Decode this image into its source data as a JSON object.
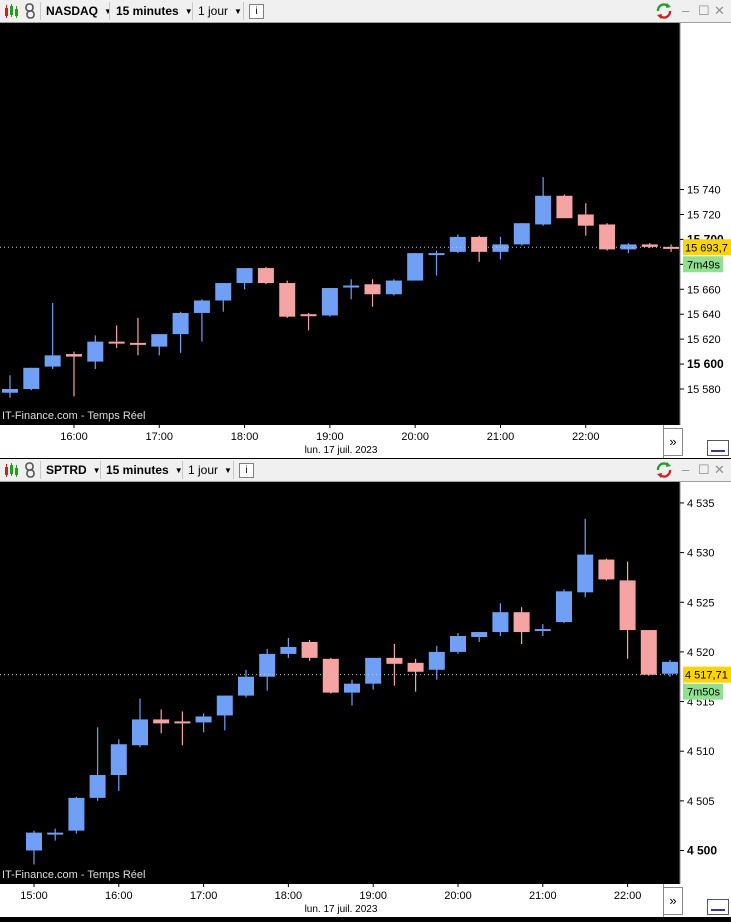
{
  "colors": {
    "up_candle": "#6fa0f5",
    "down_candle": "#f5a3a3",
    "price_tag": "#ffd400",
    "timer_tag": "#90e090"
  },
  "icons": [
    "candlestick-chart-icon",
    "link-icon",
    "info-icon",
    "refresh-icon",
    "minimize-icon",
    "restore-icon",
    "close-icon"
  ],
  "charts": [
    {
      "toolbar": {
        "symbol": "NASDAQ",
        "interval": "15 minutes",
        "period": "1 jour",
        "info": "i"
      },
      "window_buttons": {
        "minimize": "–",
        "restore": "☐",
        "close": "✕"
      },
      "source_label": "IT-Finance.com - Temps Réel",
      "date_label": "lun. 17 juil. 2023",
      "current_price": "15 693,7",
      "countdown": "7m49s",
      "scroll_label": "»"
    },
    {
      "toolbar": {
        "symbol": "SPTRD",
        "interval": "15 minutes",
        "period": "1 jour",
        "info": "i"
      },
      "window_buttons": {
        "minimize": "–",
        "restore": "☐",
        "close": "✕"
      },
      "source_label": "IT-Finance.com - Temps Réel",
      "date_label": "lun. 17 juil. 2023",
      "current_price": "4 517,71",
      "countdown": "7m50s",
      "scroll_label": "»"
    }
  ],
  "chart_data": [
    {
      "type": "candlestick",
      "title": "NASDAQ",
      "interval": "15 minutes",
      "ylim": [
        15564,
        15752
      ],
      "y_ticks": [
        15580,
        15600,
        15620,
        15640,
        15660,
        15680,
        15700,
        15720,
        15740
      ],
      "y_tick_labels": [
        "15 580",
        "15 600",
        "15 620",
        "15 640",
        "15 660",
        "15 680",
        "15 700",
        "15 720",
        "15 740"
      ],
      "bold_ticks": [
        "15 600",
        "15 700"
      ],
      "x_tick_labels": [
        "16:00",
        "17:00",
        "18:00",
        "19:00",
        "20:00",
        "21:00",
        "22:00"
      ],
      "x_tick_times": [
        "16:00",
        "17:00",
        "18:00",
        "19:00",
        "20:00",
        "21:00",
        "22:00"
      ],
      "last_price": 15693.7,
      "candles": [
        {
          "time": "15:15",
          "open": 15577,
          "high": 15591,
          "low": 15573,
          "close": 15580
        },
        {
          "time": "15:30",
          "open": 15580,
          "high": 15597,
          "low": 15579,
          "close": 15597
        },
        {
          "time": "15:45",
          "open": 15598,
          "high": 15649,
          "low": 15596,
          "close": 15607
        },
        {
          "time": "16:00",
          "open": 15608,
          "high": 15610,
          "low": 15574,
          "close": 15606
        },
        {
          "time": "16:15",
          "open": 15602,
          "high": 15623,
          "low": 15596,
          "close": 15618
        },
        {
          "time": "16:30",
          "open": 15618,
          "high": 15631,
          "low": 15613,
          "close": 15617
        },
        {
          "time": "16:45",
          "open": 15617,
          "high": 15637,
          "low": 15607,
          "close": 15616
        },
        {
          "time": "17:00",
          "open": 15614,
          "high": 15624,
          "low": 15607,
          "close": 15624
        },
        {
          "time": "17:15",
          "open": 15624,
          "high": 15642,
          "low": 15609,
          "close": 15641
        },
        {
          "time": "17:30",
          "open": 15641,
          "high": 15652,
          "low": 15618,
          "close": 15651
        },
        {
          "time": "17:45",
          "open": 15651,
          "high": 15663,
          "low": 15642,
          "close": 15665
        },
        {
          "time": "18:00",
          "open": 15665,
          "high": 15677,
          "low": 15660,
          "close": 15677
        },
        {
          "time": "18:15",
          "open": 15677,
          "high": 15678,
          "low": 15664,
          "close": 15665
        },
        {
          "time": "18:30",
          "open": 15665,
          "high": 15667,
          "low": 15637,
          "close": 15638
        },
        {
          "time": "18:45",
          "open": 15640,
          "high": 15641,
          "low": 15627,
          "close": 15639
        },
        {
          "time": "19:00",
          "open": 15639,
          "high": 15661,
          "low": 15638,
          "close": 15661
        },
        {
          "time": "19:15",
          "open": 15662,
          "high": 15668,
          "low": 15652,
          "close": 15663
        },
        {
          "time": "19:30",
          "open": 15664,
          "high": 15668,
          "low": 15646,
          "close": 15656
        },
        {
          "time": "19:45",
          "open": 15656,
          "high": 15668,
          "low": 15655,
          "close": 15667
        },
        {
          "time": "20:00",
          "open": 15667,
          "high": 15689,
          "low": 15667,
          "close": 15689
        },
        {
          "time": "20:15",
          "open": 15689,
          "high": 15691,
          "low": 15671,
          "close": 15689
        },
        {
          "time": "20:30",
          "open": 15690,
          "high": 15704,
          "low": 15689,
          "close": 15702
        },
        {
          "time": "20:45",
          "open": 15702,
          "high": 15703,
          "low": 15682,
          "close": 15690
        },
        {
          "time": "21:00",
          "open": 15690,
          "high": 15702,
          "low": 15684,
          "close": 15696
        },
        {
          "time": "21:15",
          "open": 15696,
          "high": 15713,
          "low": 15695,
          "close": 15713
        },
        {
          "time": "21:30",
          "open": 15712,
          "high": 15750,
          "low": 15711,
          "close": 15735
        },
        {
          "time": "21:45",
          "open": 15735,
          "high": 15736,
          "low": 15718,
          "close": 15717
        },
        {
          "time": "22:00",
          "open": 15720,
          "high": 15729,
          "low": 15703,
          "close": 15711
        },
        {
          "time": "22:15",
          "open": 15712,
          "high": 15713,
          "low": 15691,
          "close": 15692
        },
        {
          "time": "22:30",
          "open": 15692,
          "high": 15697,
          "low": 15689,
          "close": 15696
        },
        {
          "time": "22:45",
          "open": 15696,
          "high": 15697,
          "low": 15693,
          "close": 15694
        },
        {
          "time": "23:00",
          "open": 15694,
          "high": 15696,
          "low": 15690,
          "close": 15693.7
        }
      ]
    },
    {
      "type": "candlestick",
      "title": "SPTRD",
      "interval": "15 minutes",
      "ylim": [
        4497.5,
        4536.5
      ],
      "y_ticks": [
        4500,
        4505,
        4510,
        4515,
        4520,
        4525,
        4530,
        4535
      ],
      "y_tick_labels": [
        "4 500",
        "4 505",
        "4 510",
        "4 515",
        "4 520",
        "4 525",
        "4 530",
        "4 535"
      ],
      "bold_ticks": [
        "4 500"
      ],
      "x_tick_labels": [
        "15:00",
        "16:00",
        "17:00",
        "18:00",
        "19:00",
        "20:00",
        "21:00",
        "22:00"
      ],
      "x_tick_times": [
        "15:00",
        "16:00",
        "17:00",
        "18:00",
        "19:00",
        "20:00",
        "21:00",
        "22:00"
      ],
      "last_price": 4517.71,
      "candles": [
        {
          "time": "15:00",
          "open": 4500.0,
          "high": 4502.0,
          "low": 4498.6,
          "close": 4501.8
        },
        {
          "time": "15:15",
          "open": 4501.7,
          "high": 4502.2,
          "low": 4501.0,
          "close": 4501.8
        },
        {
          "time": "15:30",
          "open": 4502.0,
          "high": 4505.4,
          "low": 4501.7,
          "close": 4505.3
        },
        {
          "time": "15:45",
          "open": 4505.3,
          "high": 4512.4,
          "low": 4505.0,
          "close": 4507.6
        },
        {
          "time": "16:00",
          "open": 4507.6,
          "high": 4511.2,
          "low": 4506.0,
          "close": 4510.7
        },
        {
          "time": "16:15",
          "open": 4510.6,
          "high": 4515.3,
          "low": 4510.4,
          "close": 4513.2
        },
        {
          "time": "16:30",
          "open": 4513.2,
          "high": 4514.2,
          "low": 4511.8,
          "close": 4512.8
        },
        {
          "time": "16:45",
          "open": 4513.0,
          "high": 4514.0,
          "low": 4510.6,
          "close": 4512.9
        },
        {
          "time": "17:00",
          "open": 4512.9,
          "high": 4513.8,
          "low": 4511.9,
          "close": 4513.5
        },
        {
          "time": "17:15",
          "open": 4513.6,
          "high": 4515.6,
          "low": 4512.1,
          "close": 4515.6
        },
        {
          "time": "17:30",
          "open": 4515.6,
          "high": 4518.2,
          "low": 4515.4,
          "close": 4517.5
        },
        {
          "time": "17:45",
          "open": 4517.5,
          "high": 4520.3,
          "low": 4516.1,
          "close": 4519.8
        },
        {
          "time": "18:00",
          "open": 4519.8,
          "high": 4521.4,
          "low": 4519.4,
          "close": 4520.5
        },
        {
          "time": "18:15",
          "open": 4521.0,
          "high": 4521.2,
          "low": 4519.1,
          "close": 4519.4
        },
        {
          "time": "18:30",
          "open": 4519.3,
          "high": 4519.4,
          "low": 4515.8,
          "close": 4515.9
        },
        {
          "time": "18:45",
          "open": 4515.9,
          "high": 4517.2,
          "low": 4514.6,
          "close": 4516.8
        },
        {
          "time": "19:00",
          "open": 4516.8,
          "high": 4519.4,
          "low": 4516.2,
          "close": 4519.4
        },
        {
          "time": "19:15",
          "open": 4519.4,
          "high": 4520.8,
          "low": 4516.6,
          "close": 4518.8
        },
        {
          "time": "19:30",
          "open": 4518.9,
          "high": 4519.3,
          "low": 4516.0,
          "close": 4518.0
        },
        {
          "time": "19:45",
          "open": 4518.2,
          "high": 4520.6,
          "low": 4517.2,
          "close": 4520.0
        },
        {
          "time": "20:00",
          "open": 4520.0,
          "high": 4521.9,
          "low": 4519.8,
          "close": 4521.6
        },
        {
          "time": "20:15",
          "open": 4521.5,
          "high": 4521.9,
          "low": 4521.0,
          "close": 4522.0
        },
        {
          "time": "20:30",
          "open": 4522.0,
          "high": 4524.9,
          "low": 4521.6,
          "close": 4524.0
        },
        {
          "time": "20:45",
          "open": 4524.0,
          "high": 4524.5,
          "low": 4520.8,
          "close": 4522.0
        },
        {
          "time": "21:00",
          "open": 4522.1,
          "high": 4522.8,
          "low": 4521.6,
          "close": 4522.3
        },
        {
          "time": "21:15",
          "open": 4523.0,
          "high": 4526.3,
          "low": 4522.9,
          "close": 4526.1
        },
        {
          "time": "21:30",
          "open": 4526.0,
          "high": 4533.4,
          "low": 4525.5,
          "close": 4529.8
        },
        {
          "time": "21:45",
          "open": 4529.3,
          "high": 4529.4,
          "low": 4527.2,
          "close": 4527.3
        },
        {
          "time": "22:00",
          "open": 4527.2,
          "high": 4529.1,
          "low": 4519.3,
          "close": 4522.2
        },
        {
          "time": "22:15",
          "open": 4522.2,
          "high": 4522.2,
          "low": 4517.6,
          "close": 4517.7
        },
        {
          "time": "22:30",
          "open": 4517.8,
          "high": 4519.2,
          "low": 4517.5,
          "close": 4519.0
        },
        {
          "time": "22:45",
          "open": 4518.8,
          "high": 4519.1,
          "low": 4518.3,
          "close": 4518.5
        },
        {
          "time": "23:00",
          "open": 4518.4,
          "high": 4518.7,
          "low": 4517.6,
          "close": 4517.71
        }
      ]
    }
  ]
}
